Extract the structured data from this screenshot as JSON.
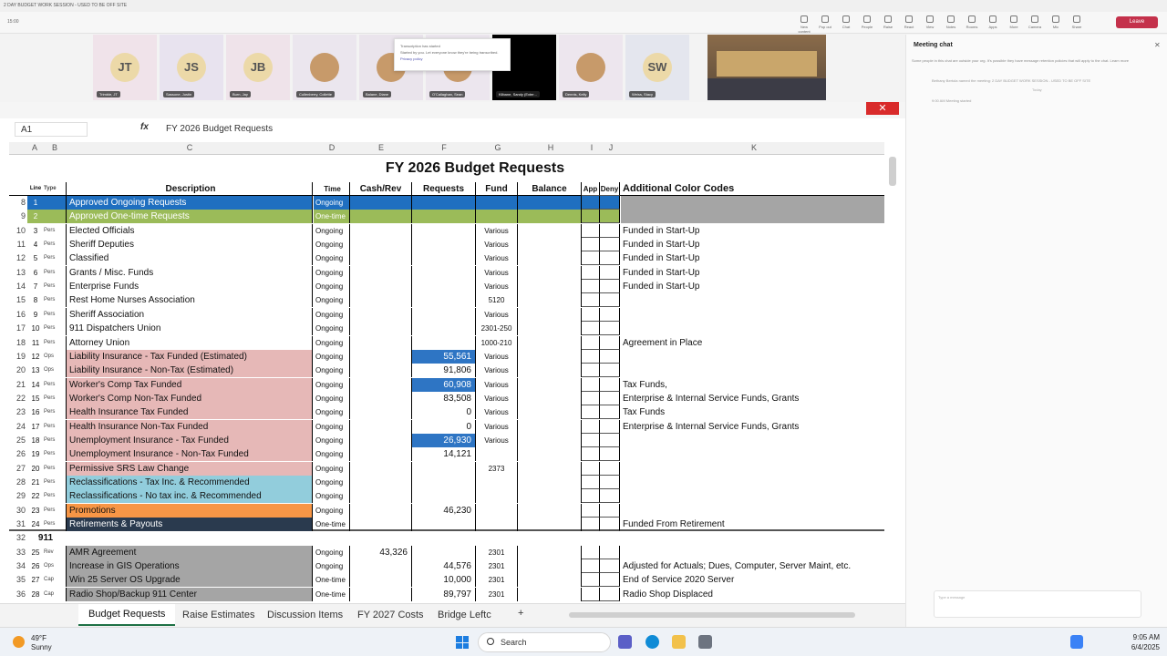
{
  "window": {
    "title": "2 DAY BUDGET WORK SESSION - USED TO BE OFF SITE",
    "time_label": "15:00"
  },
  "toolbar": {
    "items": [
      "New content",
      "Pop out",
      "Chat",
      "People",
      "Raise",
      "React",
      "View",
      "Notes",
      "Rooms",
      "Apps",
      "More",
      "Camera",
      "Mic",
      "Share"
    ],
    "leave_label": "Leave"
  },
  "participants": [
    {
      "initials": "JT",
      "name": "Trimble, JT"
    },
    {
      "initials": "JS",
      "name": "Sassone, Justin"
    },
    {
      "initials": "JB",
      "name": "Burn, Jay"
    },
    {
      "initials": "",
      "name": "Cullenberry, Collette"
    },
    {
      "initials": "",
      "name": "Balane, Diane"
    },
    {
      "initials": "",
      "name": "O'Callaghan, Sean"
    },
    {
      "initials": "",
      "name": "Kilbane, Sandy (Exter..."
    },
    {
      "initials": "",
      "name": "Dennis, Kelly"
    },
    {
      "initials": "SW",
      "name": "Weiss, Stacy"
    }
  ],
  "toast": {
    "title": "Transcription has started",
    "body": "Started by you. Let everyone know they're being transcribed.",
    "link": "Privacy policy"
  },
  "chat": {
    "title": "Meeting chat",
    "notice": "Some people in this chat are outside your org. It's possible they have message retention policies that will apply to the chat. Learn more",
    "line1": "Bethany Bertola named the meeting: 2 DAY BUDGET WORK SESSION - USED TO BE OFF SITE",
    "today": "Today",
    "line2": "9:00 AM    Meeting started",
    "input_placeholder": "Type a message"
  },
  "sheet": {
    "namebox": "A1",
    "formula": "FY 2026 Budget Requests",
    "columns": [
      "A",
      "B",
      "C",
      "D",
      "E",
      "F",
      "G",
      "H",
      "I",
      "J",
      "K"
    ],
    "title": "FY 2026 Budget Requests",
    "headers": {
      "line": "Line",
      "type": "Type",
      "desc": "Description",
      "time": "Time",
      "cash": "Cash/Rev",
      "req": "Requests",
      "fund": "Fund",
      "bal": "Balance",
      "app": "App",
      "deny": "Deny",
      "codes": "Additional Color Codes"
    },
    "rows": [
      {
        "n": "8",
        "line": "1",
        "type": "",
        "desc": "Approved Ongoing Requests",
        "time": "Ongoing",
        "cash": "",
        "req": "",
        "fund": "",
        "code": ""
      },
      {
        "n": "9",
        "line": "2",
        "type": "",
        "desc": "Approved One-time Requests",
        "time": "One-time",
        "cash": "",
        "req": "",
        "fund": "",
        "code": ""
      },
      {
        "n": "10",
        "line": "3",
        "type": "Pers",
        "desc": "Elected Officials",
        "time": "Ongoing",
        "cash": "",
        "req": "",
        "fund": "Various",
        "code": "Funded in Start-Up"
      },
      {
        "n": "11",
        "line": "4",
        "type": "Pers",
        "desc": "Sheriff Deputies",
        "time": "Ongoing",
        "cash": "",
        "req": "",
        "fund": "Various",
        "code": "Funded in Start-Up"
      },
      {
        "n": "12",
        "line": "5",
        "type": "Pers",
        "desc": "Classified",
        "time": "Ongoing",
        "cash": "",
        "req": "",
        "fund": "Various",
        "code": "Funded in Start-Up"
      },
      {
        "n": "13",
        "line": "6",
        "type": "Pers",
        "desc": "Grants / Misc. Funds",
        "time": "Ongoing",
        "cash": "",
        "req": "",
        "fund": "Various",
        "code": "Funded in Start-Up"
      },
      {
        "n": "14",
        "line": "7",
        "type": "Pers",
        "desc": "Enterprise Funds",
        "time": "Ongoing",
        "cash": "",
        "req": "",
        "fund": "Various",
        "code": "Funded in Start-Up"
      },
      {
        "n": "15",
        "line": "8",
        "type": "Pers",
        "desc": "Rest Home Nurses Association",
        "time": "Ongoing",
        "cash": "",
        "req": "",
        "fund": "5120",
        "code": ""
      },
      {
        "n": "16",
        "line": "9",
        "type": "Pers",
        "desc": "Sheriff Association",
        "time": "Ongoing",
        "cash": "",
        "req": "",
        "fund": "Various",
        "code": ""
      },
      {
        "n": "17",
        "line": "10",
        "type": "Pers",
        "desc": "911 Dispatchers Union",
        "time": "Ongoing",
        "cash": "",
        "req": "",
        "fund": "2301-250",
        "code": ""
      },
      {
        "n": "18",
        "line": "11",
        "type": "Pers",
        "desc": "Attorney Union",
        "time": "Ongoing",
        "cash": "",
        "req": "",
        "fund": "1000-210",
        "code": "Agreement in Place"
      },
      {
        "n": "19",
        "line": "12",
        "type": "Ops",
        "desc": "Liability Insurance - Tax Funded (Estimated)",
        "time": "Ongoing",
        "cash": "",
        "req": "55,561",
        "fund": "Various",
        "code": ""
      },
      {
        "n": "20",
        "line": "13",
        "type": "Ops",
        "desc": "Liability Insurance - Non-Tax (Estimated)",
        "time": "Ongoing",
        "cash": "",
        "req": "91,806",
        "fund": "Various",
        "code": ""
      },
      {
        "n": "21",
        "line": "14",
        "type": "Pers",
        "desc": "Worker's Comp Tax Funded",
        "time": "Ongoing",
        "cash": "",
        "req": "60,908",
        "fund": "Various",
        "code": "Tax Funds,"
      },
      {
        "n": "22",
        "line": "15",
        "type": "Pers",
        "desc": "Worker's Comp Non-Tax Funded",
        "time": "Ongoing",
        "cash": "",
        "req": "83,508",
        "fund": "Various",
        "code": "Enterprise & Internal Service Funds, Grants"
      },
      {
        "n": "23",
        "line": "16",
        "type": "Pers",
        "desc": "Health Insurance Tax Funded",
        "time": "Ongoing",
        "cash": "",
        "req": "0",
        "fund": "Various",
        "code": "Tax Funds"
      },
      {
        "n": "24",
        "line": "17",
        "type": "Pers",
        "desc": "Health Insurance Non-Tax Funded",
        "time": "Ongoing",
        "cash": "",
        "req": "0",
        "fund": "Various",
        "code": "Enterprise & Internal Service Funds, Grants"
      },
      {
        "n": "25",
        "line": "18",
        "type": "Pers",
        "desc": "Unemployment Insurance - Tax Funded",
        "time": "Ongoing",
        "cash": "",
        "req": "26,930",
        "fund": "Various",
        "code": ""
      },
      {
        "n": "26",
        "line": "19",
        "type": "Pers",
        "desc": "Unemployment Insurance - Non-Tax Funded",
        "time": "Ongoing",
        "cash": "",
        "req": "14,121",
        "fund": "",
        "code": ""
      },
      {
        "n": "27",
        "line": "20",
        "type": "Pers",
        "desc": "Permissive SRS Law Change",
        "time": "Ongoing",
        "cash": "",
        "req": "",
        "fund": "2373",
        "code": ""
      },
      {
        "n": "28",
        "line": "21",
        "type": "Pers",
        "desc": "Reclassifications - Tax Inc. & Recommended",
        "time": "Ongoing",
        "cash": "",
        "req": "",
        "fund": "",
        "code": ""
      },
      {
        "n": "29",
        "line": "22",
        "type": "Pers",
        "desc": "Reclassifications - No tax inc. & Recommended",
        "time": "Ongoing",
        "cash": "",
        "req": "",
        "fund": "",
        "code": ""
      },
      {
        "n": "30",
        "line": "23",
        "type": "Pers",
        "desc": "Promotions",
        "time": "Ongoing",
        "cash": "",
        "req": "46,230",
        "fund": "",
        "code": ""
      },
      {
        "n": "31",
        "line": "24",
        "type": "Pers",
        "desc": "Retirements & Payouts",
        "time": "One-time",
        "cash": "",
        "req": "",
        "fund": "",
        "code": "Funded From Retirement"
      },
      {
        "n": "32",
        "line": "911",
        "type": "",
        "desc": "",
        "time": "",
        "cash": "",
        "req": "",
        "fund": "",
        "code": ""
      },
      {
        "n": "33",
        "line": "25",
        "type": "Rev",
        "desc": "AMR Agreement",
        "time": "Ongoing",
        "cash": "43,326",
        "req": "",
        "fund": "2301",
        "code": ""
      },
      {
        "n": "34",
        "line": "26",
        "type": "Ops",
        "desc": "Increase in GIS Operations",
        "time": "Ongoing",
        "cash": "",
        "req": "44,576",
        "fund": "2301",
        "code": "Adjusted for Actuals; Dues, Computer, Server Maint, etc."
      },
      {
        "n": "35",
        "line": "27",
        "type": "Cap",
        "desc": "Win 25 Server OS Upgrade",
        "time": "One-time",
        "cash": "",
        "req": "10,000",
        "fund": "2301",
        "code": "End of Service 2020 Server"
      },
      {
        "n": "36",
        "line": "28",
        "type": "Cap",
        "desc": "Radio Shop/Backup 911 Center",
        "time": "One-time",
        "cash": "",
        "req": "89,797",
        "fund": "2301",
        "code": "Radio Shop Displaced"
      }
    ],
    "tabs": [
      "Budget Requests",
      "Raise Estimates",
      "Discussion Items",
      "FY 2027 Costs",
      "Bridge Leftc"
    ],
    "colors": {
      "blue": "#1f6fc0",
      "green": "#9bbb59",
      "pink": "#e6b8b7",
      "cyan": "#92cddc",
      "orange": "#f79646",
      "navy": "#2a3a4e",
      "grey": "#a5a5a5",
      "req_blue": "#2e75c4"
    }
  },
  "taskbar": {
    "weather_temp": "49°F",
    "weather_desc": "Sunny",
    "search_label": "Search",
    "time": "9:05 AM",
    "date": "6/4/2025"
  }
}
